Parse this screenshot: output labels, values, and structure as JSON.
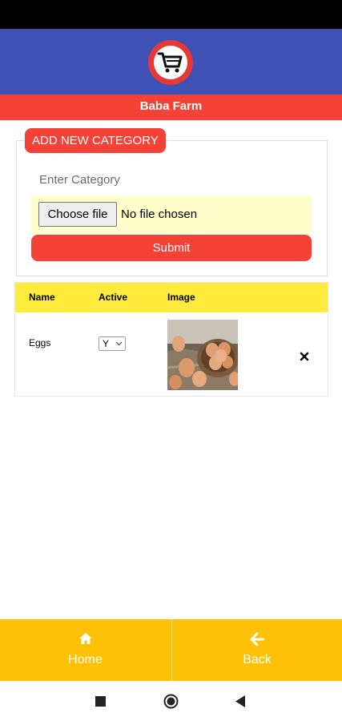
{
  "header": {
    "logo_icon": "shopping-cart-icon",
    "title": "Baba Farm"
  },
  "form": {
    "legend": "ADD NEW CATEGORY",
    "category_placeholder": "Enter Category",
    "category_value": "",
    "choose_file_label": "Choose file",
    "file_status": "No file chosen",
    "submit_label": "Submit"
  },
  "table": {
    "headers": [
      "Name",
      "Active",
      "Image"
    ],
    "rows": [
      {
        "name": "Eggs",
        "active": "Y",
        "image_icon": "eggs-image",
        "delete_icon": "close-icon"
      }
    ]
  },
  "bottom_nav": {
    "items": [
      {
        "label": "Home",
        "icon": "home-icon"
      },
      {
        "label": "Back",
        "icon": "arrow-left-icon"
      }
    ]
  },
  "system_nav": {
    "icons": [
      "recents-icon",
      "home-circle-icon",
      "back-triangle-icon"
    ]
  },
  "colors": {
    "header_blue": "#3f51b5",
    "accent_red": "#f44336",
    "table_header_yellow": "#ffeb3b",
    "file_row_bg": "#ffffcc",
    "bottom_nav_amber": "#ffc107"
  }
}
